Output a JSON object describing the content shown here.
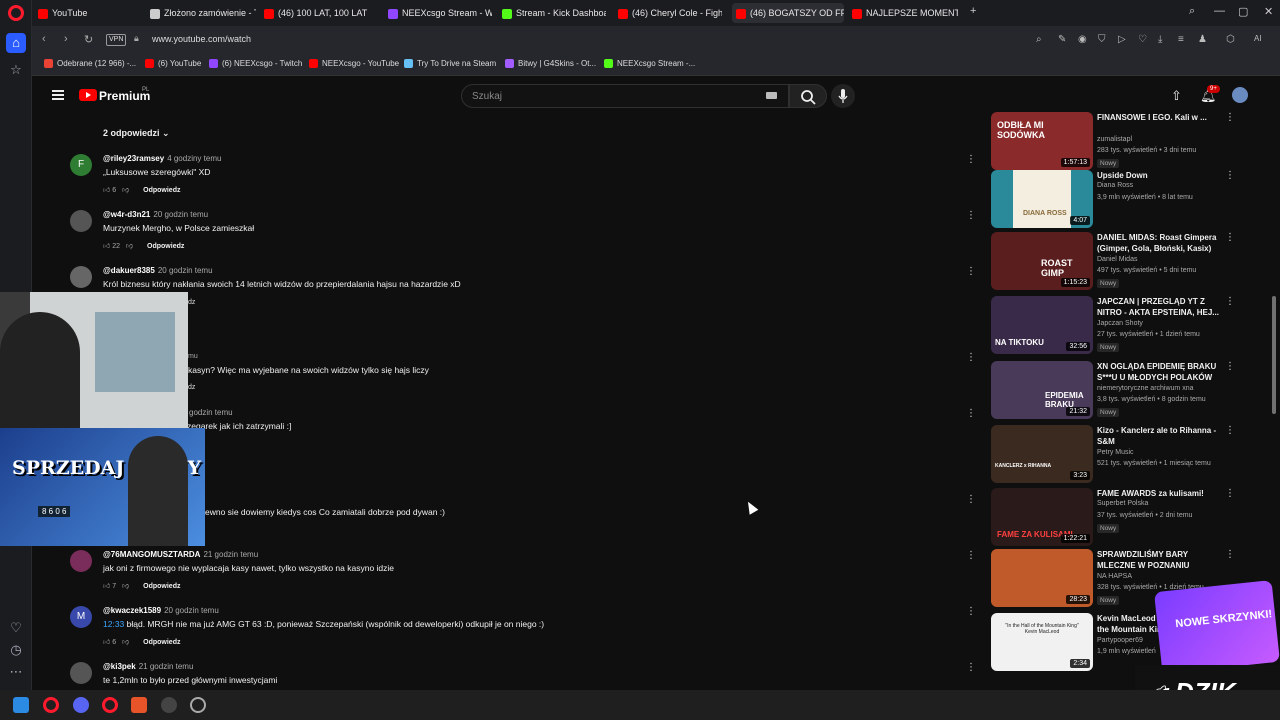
{
  "browser": {
    "tabs": [
      {
        "label": "YouTube",
        "color": "#ff0000"
      },
      {
        "label": "Złożono zamówienie - Tw",
        "color": "#cccccc"
      },
      {
        "label": "(46) 100 LAT, 100 LAT !!! -",
        "color": "#ff0000"
      },
      {
        "label": "NEEXcsgo Stream - Watc",
        "color": "#9146ff"
      },
      {
        "label": "Stream - Kick Dashboard",
        "color": "#53fc18"
      },
      {
        "label": "(46) Cheryl Cole - Figh",
        "color": "#ff0000"
      },
      {
        "label": "(46) BOGATSZY OD FF",
        "color": "#ff0000"
      },
      {
        "label": "NAJLEPSZE MOMENTY PC",
        "color": "#ff0000"
      }
    ],
    "url": "www.youtube.com/watch",
    "vpn_label": "VPN",
    "bookmarks": [
      {
        "label": "Odebrane (12 966) -...",
        "color": "#ea4335"
      },
      {
        "label": "(6) YouTube",
        "color": "#ff0000"
      },
      {
        "label": "(6) NEEXcsgo - Twitch",
        "color": "#9146ff"
      },
      {
        "label": "NEEXcsgo - YouTube",
        "color": "#ff0000"
      },
      {
        "label": "Try To Drive na Steam",
        "color": "#66c0f4"
      },
      {
        "label": "Bitwy | G4Skins - Ot...",
        "color": "#a35cff"
      },
      {
        "label": "NEEXcsgo Stream -...",
        "color": "#53fc18"
      }
    ]
  },
  "youtube": {
    "brand": "Premium",
    "region": "PL",
    "search_placeholder": "Szukaj",
    "notif_count": "9+"
  },
  "comments": {
    "replies_label": "2 odpowiedzi",
    "items": [
      {
        "initial": "F",
        "avatar_color": "#2e7d32",
        "author": "@riley23ramsey",
        "time": "4 godziny temu",
        "text": "„Luksusowe szeregówki\" XD",
        "likes": "6",
        "reply": "Odpowiedz"
      },
      {
        "initial": "",
        "avatar_color": "#555555",
        "author": "@w4r-d3n21",
        "time": "20 godzin temu",
        "text": "Murzynek Mergho, w Polsce zamieszkał",
        "likes": "22",
        "reply": "Odpowiedz"
      },
      {
        "initial": "",
        "avatar_color": "#666666",
        "author": "@dakuer8385",
        "time": "20 godzin temu",
        "text": "Król biznesu który nakłania swoich 14 letnich widzów do przepierdalania hajsu na hazardzie xD",
        "likes": "",
        "reply": ""
      },
      {
        "initial": "",
        "avatar_color": "#444444",
        "author": "",
        "time": "",
        "text": "kasyn? Więc ma wyjebane na swoich widzów tylko się hajs liczy",
        "likes": "",
        "reply": ""
      },
      {
        "initial": "",
        "avatar_color": "#444444",
        "author": "",
        "time": "godzin temu",
        "text": "zegarek jak ich zatrzymali :]",
        "likes": "",
        "reply": ""
      },
      {
        "initial": "",
        "avatar_color": "#444444",
        "author": "",
        "time": "",
        "text": "ewno sie dowiemy kiedys cos  Co zamiatali dobrze pod dywan :)",
        "likes": "",
        "reply": ""
      },
      {
        "initial": "",
        "avatar_color": "#7a2d5a",
        "author": "@76MANGOMUSZTARDA",
        "time": "21 godzin temu",
        "text": "jak oni z firmowego nie wyplacaja kasy nawet, tylko wszystko na kasyno idzie",
        "likes": "7",
        "reply": "Odpowiedz"
      },
      {
        "initial": "M",
        "avatar_color": "#3949ab",
        "author": "@kwaczek1589",
        "time": "20 godzin temu",
        "timestamp": "12:33",
        "text": " błąd. MRGH nie ma już AMG GT 63 :D, ponieważ Szczepański (wspólnik od deweloperki) odkupił je on niego :)",
        "likes": "6",
        "reply": "Odpowiedz"
      },
      {
        "initial": "",
        "avatar_color": "#555555",
        "author": "@ki3pek",
        "time": "21 godzin temu",
        "text": "te 1,2mln to było przed głównymi inwestycjami",
        "likes": "",
        "reply": ""
      }
    ],
    "partial_labels": {
      "dz1": "dz",
      "mu": "mu",
      "dz2": "dz"
    }
  },
  "suggestions": [
    {
      "title": "FINANSOWE I EGO. Kali w ...",
      "channel": "zumalistapl",
      "meta": "283 tys. wyświetleń • 3 dni temu",
      "badge": "Nowy",
      "duration": "1:57:13",
      "thumb_text": "ODBIŁA MI SODÓWKA",
      "thumb_color": "#8a2a2a"
    },
    {
      "title": "Upside Down",
      "channel": "Diana Ross",
      "meta": "3,9 mln wyświetleń • 8 lat temu",
      "badge": "",
      "duration": "4:07",
      "thumb_text": "DIANA ROSS",
      "thumb_color": "#f3eee0"
    },
    {
      "title": "DANIEL MIDAS: Roast Gimpera (Gimper, Gola, Błoński, Kasix) |...",
      "channel": "Daniel Midas",
      "meta": "497 tys. wyświetleń • 5 dni temu",
      "badge": "Nowy",
      "duration": "1:15:23",
      "thumb_text": "ROAST GIMP",
      "thumb_color": "#5a1e1e"
    },
    {
      "title": "JAPCZAN | PRZEGLĄD YT Z NITRO - AKTA EPSTEINA, HEJ...",
      "channel": "Japczan Shoty",
      "meta": "27 tys. wyświetleń • 1 dzień temu",
      "badge": "Nowy",
      "duration": "32:56",
      "thumb_text": "NA TIKTOKU",
      "thumb_color": "#3a2a4a"
    },
    {
      "title": "XN OGLĄDA EPIDEMIĘ BRAKU S***U U MŁODYCH POLAKÓW",
      "channel": "niemerytoryczne archiwum xna",
      "meta": "3,8 tys. wyświetleń • 8 godzin temu",
      "badge": "Nowy",
      "duration": "21:32",
      "thumb_text": "EPIDEMIA BRAKU",
      "thumb_color": "#4a3a5a"
    },
    {
      "title": "Kizo - Kanclerz ale to Rihanna - S&M",
      "channel": "Petry Music",
      "meta": "521 tys. wyświetleń • 1 miesiąc temu",
      "badge": "",
      "duration": "3:23",
      "thumb_text": "KANCLERZ x RIHANNA",
      "thumb_color": "#3a2a20"
    },
    {
      "title": "FAME AWARDS za kulisami!",
      "channel": "Superbet Polska",
      "meta": "37 tys. wyświetleń • 2 dni temu",
      "badge": "Nowy",
      "duration": "1:22:21",
      "thumb_text": "FAME ZA KULISAMI",
      "thumb_color": "#2a1a1a"
    },
    {
      "title": "SPRAWDZILIŚMY BARY MLECZNE W POZNANIU",
      "channel": "NA HAPSA",
      "meta": "328 tys. wyświetleń • 1 dzień temu",
      "badge": "Nowy",
      "duration": "28:23",
      "thumb_text": "",
      "thumb_color": "#c05a2a"
    },
    {
      "title": "Kevin MacLeod ~ In the Hall of the Mountain King",
      "channel": "Partypooper69",
      "meta": "1,9 mln wyświetleń",
      "badge": "",
      "duration": "2:34",
      "thumb_text": "\"In the Hall of the Mountain King\" Kevin MacLeod",
      "thumb_color": "#f1f1f1"
    }
  ],
  "overlays": {
    "promo_title": "SPRZEDAJ SKINY",
    "promo_code": "8 6 0 6",
    "dzik_text": "DZIK",
    "dzik_box_text": "NOWE SKRZYNKI!"
  }
}
